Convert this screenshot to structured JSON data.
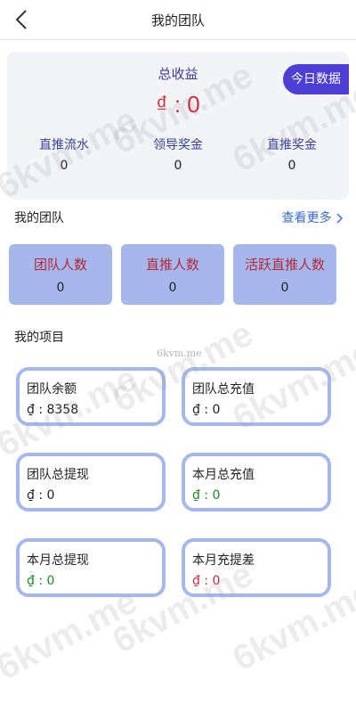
{
  "header": {
    "title": "我的团队",
    "back_icon": "chevron-left-icon"
  },
  "summary": {
    "total_label": "总收益",
    "total_value": "₫ : 0",
    "today_button": "今日数据",
    "stats": [
      {
        "label": "直推流水",
        "value": "0"
      },
      {
        "label": "领导奖金",
        "value": "0"
      },
      {
        "label": "直推奖金",
        "value": "0"
      }
    ]
  },
  "team_section": {
    "title": "我的团队",
    "more_link": "查看更多",
    "cards": [
      {
        "label": "团队人数",
        "value": "0"
      },
      {
        "label": "直推人数",
        "value": "0"
      },
      {
        "label": "活跃直推人数",
        "value": "0"
      }
    ]
  },
  "projects_section": {
    "title": "我的项目",
    "items": [
      {
        "label": "团队余额",
        "value": "₫ : 8358"
      },
      {
        "label": "团队总充值",
        "value": "₫ : 0"
      },
      {
        "label": "团队总提现",
        "value": "₫ : 0"
      },
      {
        "label": "本月总充值",
        "value": "₫ : 0"
      },
      {
        "label": "本月总提现",
        "value": "₫ : 0"
      },
      {
        "label": "本月充提差",
        "value": "₫ : 0"
      }
    ]
  },
  "watermark": {
    "text": "6kvm.me",
    "small_text": "6kvm.me"
  },
  "colors": {
    "accent": "#4b3fd6",
    "card": "#a6b7ec",
    "link": "#3a6bd8",
    "negative": "#c8283a",
    "positive": "#1a8a2a"
  }
}
